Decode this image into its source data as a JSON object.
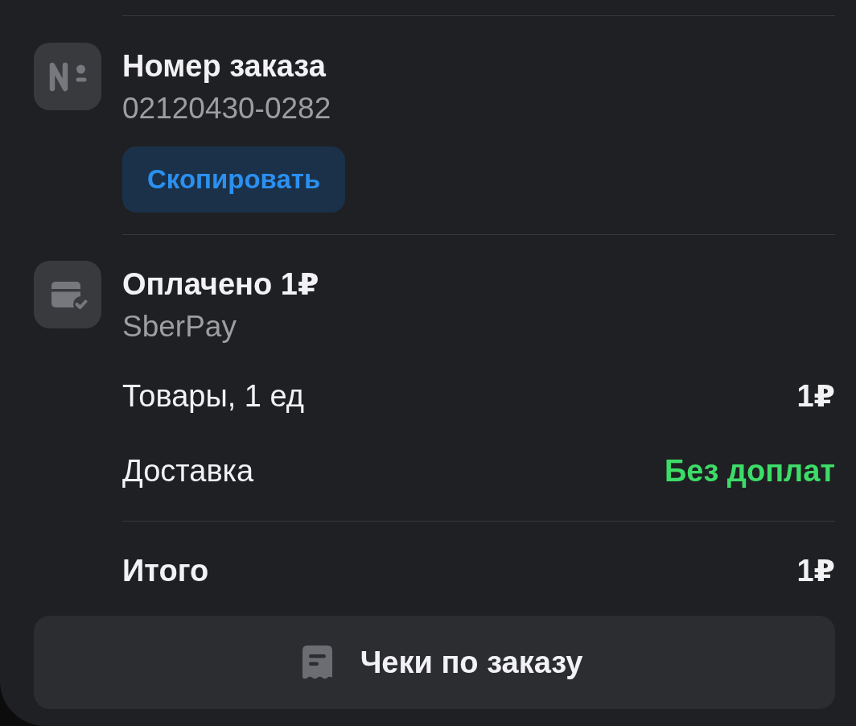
{
  "order_number": {
    "title": "Номер заказа",
    "value": "02120430-0282",
    "copy_button": "Скопировать"
  },
  "payment": {
    "title": "Оплачено 1₽",
    "method": "SberPay"
  },
  "lines": [
    {
      "label": "Товары, 1 ед",
      "value": "1₽",
      "kind": "amount"
    },
    {
      "label": "Доставка",
      "value": "Без доплат",
      "kind": "free"
    }
  ],
  "total": {
    "label": "Итого",
    "value": "1₽"
  },
  "receipts_button": {
    "label": "Чеки по заказу"
  }
}
